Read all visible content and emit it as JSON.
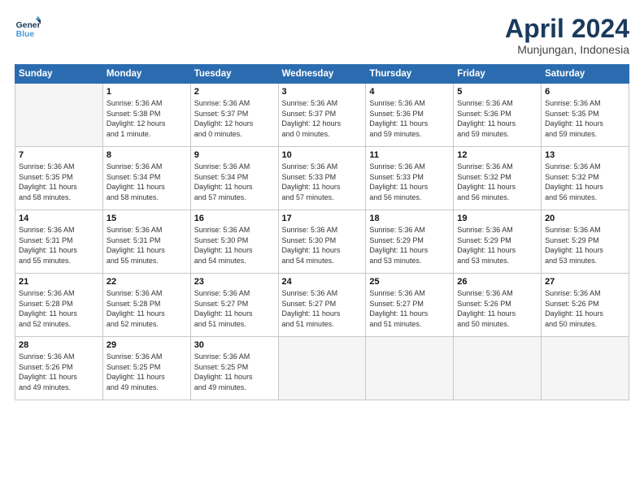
{
  "header": {
    "logo_line1": "General",
    "logo_line2": "Blue",
    "month": "April 2024",
    "location": "Munjungan, Indonesia"
  },
  "weekdays": [
    "Sunday",
    "Monday",
    "Tuesday",
    "Wednesday",
    "Thursday",
    "Friday",
    "Saturday"
  ],
  "weeks": [
    [
      {
        "day": "",
        "info": ""
      },
      {
        "day": "1",
        "info": "Sunrise: 5:36 AM\nSunset: 5:38 PM\nDaylight: 12 hours\nand 1 minute."
      },
      {
        "day": "2",
        "info": "Sunrise: 5:36 AM\nSunset: 5:37 PM\nDaylight: 12 hours\nand 0 minutes."
      },
      {
        "day": "3",
        "info": "Sunrise: 5:36 AM\nSunset: 5:37 PM\nDaylight: 12 hours\nand 0 minutes."
      },
      {
        "day": "4",
        "info": "Sunrise: 5:36 AM\nSunset: 5:36 PM\nDaylight: 11 hours\nand 59 minutes."
      },
      {
        "day": "5",
        "info": "Sunrise: 5:36 AM\nSunset: 5:36 PM\nDaylight: 11 hours\nand 59 minutes."
      },
      {
        "day": "6",
        "info": "Sunrise: 5:36 AM\nSunset: 5:35 PM\nDaylight: 11 hours\nand 59 minutes."
      }
    ],
    [
      {
        "day": "7",
        "info": "Sunrise: 5:36 AM\nSunset: 5:35 PM\nDaylight: 11 hours\nand 58 minutes."
      },
      {
        "day": "8",
        "info": "Sunrise: 5:36 AM\nSunset: 5:34 PM\nDaylight: 11 hours\nand 58 minutes."
      },
      {
        "day": "9",
        "info": "Sunrise: 5:36 AM\nSunset: 5:34 PM\nDaylight: 11 hours\nand 57 minutes."
      },
      {
        "day": "10",
        "info": "Sunrise: 5:36 AM\nSunset: 5:33 PM\nDaylight: 11 hours\nand 57 minutes."
      },
      {
        "day": "11",
        "info": "Sunrise: 5:36 AM\nSunset: 5:33 PM\nDaylight: 11 hours\nand 56 minutes."
      },
      {
        "day": "12",
        "info": "Sunrise: 5:36 AM\nSunset: 5:32 PM\nDaylight: 11 hours\nand 56 minutes."
      },
      {
        "day": "13",
        "info": "Sunrise: 5:36 AM\nSunset: 5:32 PM\nDaylight: 11 hours\nand 56 minutes."
      }
    ],
    [
      {
        "day": "14",
        "info": "Sunrise: 5:36 AM\nSunset: 5:31 PM\nDaylight: 11 hours\nand 55 minutes."
      },
      {
        "day": "15",
        "info": "Sunrise: 5:36 AM\nSunset: 5:31 PM\nDaylight: 11 hours\nand 55 minutes."
      },
      {
        "day": "16",
        "info": "Sunrise: 5:36 AM\nSunset: 5:30 PM\nDaylight: 11 hours\nand 54 minutes."
      },
      {
        "day": "17",
        "info": "Sunrise: 5:36 AM\nSunset: 5:30 PM\nDaylight: 11 hours\nand 54 minutes."
      },
      {
        "day": "18",
        "info": "Sunrise: 5:36 AM\nSunset: 5:29 PM\nDaylight: 11 hours\nand 53 minutes."
      },
      {
        "day": "19",
        "info": "Sunrise: 5:36 AM\nSunset: 5:29 PM\nDaylight: 11 hours\nand 53 minutes."
      },
      {
        "day": "20",
        "info": "Sunrise: 5:36 AM\nSunset: 5:29 PM\nDaylight: 11 hours\nand 53 minutes."
      }
    ],
    [
      {
        "day": "21",
        "info": "Sunrise: 5:36 AM\nSunset: 5:28 PM\nDaylight: 11 hours\nand 52 minutes."
      },
      {
        "day": "22",
        "info": "Sunrise: 5:36 AM\nSunset: 5:28 PM\nDaylight: 11 hours\nand 52 minutes."
      },
      {
        "day": "23",
        "info": "Sunrise: 5:36 AM\nSunset: 5:27 PM\nDaylight: 11 hours\nand 51 minutes."
      },
      {
        "day": "24",
        "info": "Sunrise: 5:36 AM\nSunset: 5:27 PM\nDaylight: 11 hours\nand 51 minutes."
      },
      {
        "day": "25",
        "info": "Sunrise: 5:36 AM\nSunset: 5:27 PM\nDaylight: 11 hours\nand 51 minutes."
      },
      {
        "day": "26",
        "info": "Sunrise: 5:36 AM\nSunset: 5:26 PM\nDaylight: 11 hours\nand 50 minutes."
      },
      {
        "day": "27",
        "info": "Sunrise: 5:36 AM\nSunset: 5:26 PM\nDaylight: 11 hours\nand 50 minutes."
      }
    ],
    [
      {
        "day": "28",
        "info": "Sunrise: 5:36 AM\nSunset: 5:26 PM\nDaylight: 11 hours\nand 49 minutes."
      },
      {
        "day": "29",
        "info": "Sunrise: 5:36 AM\nSunset: 5:25 PM\nDaylight: 11 hours\nand 49 minutes."
      },
      {
        "day": "30",
        "info": "Sunrise: 5:36 AM\nSunset: 5:25 PM\nDaylight: 11 hours\nand 49 minutes."
      },
      {
        "day": "",
        "info": ""
      },
      {
        "day": "",
        "info": ""
      },
      {
        "day": "",
        "info": ""
      },
      {
        "day": "",
        "info": ""
      }
    ]
  ]
}
